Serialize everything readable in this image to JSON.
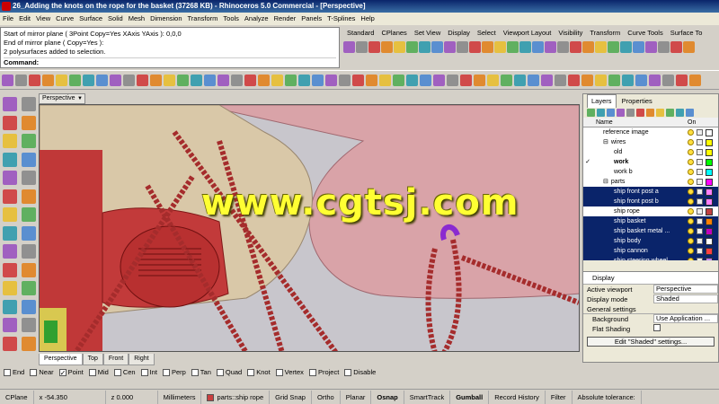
{
  "window": {
    "title": "26_Adding the knots on the rope for the basket (37268 KB) - Rhinoceros 5.0 Commercial - [Perspective]"
  },
  "menu": [
    "File",
    "Edit",
    "View",
    "Curve",
    "Surface",
    "Solid",
    "Mesh",
    "Dimension",
    "Transform",
    "Tools",
    "Analyze",
    "Render",
    "Panels",
    "T-Splines",
    "Help"
  ],
  "command_history": {
    "lines": [
      "Start of mirror plane ( 3Point  Copy=Yes  XAxis  YAxis ): 0,0,0",
      "End of mirror plane ( Copy=Yes ):",
      "2 polysurfaces added to selection."
    ],
    "prompt": "Command:"
  },
  "toolbar_tabs": [
    "Standard",
    "CPlanes",
    "Set View",
    "Display",
    "Select",
    "Viewport Layout",
    "Visibility",
    "Transform",
    "Curve Tools",
    "Surface To"
  ],
  "viewport": {
    "name": "Perspective",
    "watermark": "www.cgtsj.com",
    "tabs": [
      "Perspective",
      "Top",
      "Front",
      "Right"
    ],
    "active_tab": "Perspective"
  },
  "osnap": [
    {
      "label": "End",
      "checked": false
    },
    {
      "label": "Near",
      "checked": false
    },
    {
      "label": "Point",
      "checked": true
    },
    {
      "label": "Mid",
      "checked": false
    },
    {
      "label": "Cen",
      "checked": false
    },
    {
      "label": "Int",
      "checked": false
    },
    {
      "label": "Perp",
      "checked": false
    },
    {
      "label": "Tan",
      "checked": false
    },
    {
      "label": "Quad",
      "checked": false
    },
    {
      "label": "Knot",
      "checked": false
    },
    {
      "label": "Vertex",
      "checked": false
    },
    {
      "label": "Project",
      "checked": false
    },
    {
      "label": "Disable",
      "checked": false
    }
  ],
  "status": {
    "cplane": "CPlane",
    "x": "x -54.350",
    "z": "z 0.000",
    "units": "Millimeters",
    "layer": "parts::ship rope",
    "toggles": [
      "Grid Snap",
      "Ortho",
      "Planar",
      "Osnap",
      "SmartTrack",
      "Gumball",
      "Record History",
      "Filter",
      "Absolute tolerance:"
    ],
    "bold_toggles": [
      "Osnap",
      "Gumball"
    ]
  },
  "panels": {
    "tabs": [
      "Layers",
      "Properties"
    ],
    "active": "Layers",
    "columns": {
      "name": "Name",
      "on": "On"
    },
    "layers": [
      {
        "name": "reference image",
        "indent": 1,
        "current": false,
        "selected": false,
        "color": "#ffffff"
      },
      {
        "name": "wires",
        "indent": 1,
        "current": false,
        "selected": false,
        "color": "#ffff00",
        "expander": "⊟"
      },
      {
        "name": "old",
        "indent": 2,
        "current": false,
        "selected": false,
        "color": "#ffff00"
      },
      {
        "name": "work",
        "indent": 2,
        "current": true,
        "selected": false,
        "color": "#00ff00",
        "check": "✓"
      },
      {
        "name": "work b",
        "indent": 2,
        "current": false,
        "selected": false,
        "color": "#00ffff"
      },
      {
        "name": "parts",
        "indent": 1,
        "current": false,
        "selected": false,
        "color": "#ff00ff",
        "expander": "⊟"
      },
      {
        "name": "ship front post a",
        "indent": 2,
        "current": false,
        "selected": true,
        "color": "#ff80ff"
      },
      {
        "name": "ship front post b",
        "indent": 2,
        "current": false,
        "selected": true,
        "color": "#ff80ff"
      },
      {
        "name": "ship rope",
        "indent": 2,
        "current": false,
        "selected": false,
        "color": "#c04040"
      },
      {
        "name": "ship basket",
        "indent": 2,
        "current": false,
        "selected": true,
        "color": "#ff8000"
      },
      {
        "name": "ship basket metal ...",
        "indent": 2,
        "current": false,
        "selected": true,
        "color": "#c000c0"
      },
      {
        "name": "ship body",
        "indent": 2,
        "current": false,
        "selected": true,
        "color": "#ffffff"
      },
      {
        "name": "ship cannon",
        "indent": 2,
        "current": false,
        "selected": true,
        "color": "#ff4040"
      },
      {
        "name": "ship steering wheel",
        "indent": 2,
        "current": false,
        "selected": true,
        "color": "#c080ff"
      }
    ]
  },
  "display_panel": {
    "title": "Display",
    "active_viewport_label": "Active viewport",
    "active_viewport": "Perspective",
    "display_mode_label": "Display mode",
    "display_mode": "Shaded",
    "section": "General settings",
    "background_label": "Background",
    "background": "Use Application ...",
    "flat_shading_label": "Flat Shading",
    "button": "Edit \"Shaded\" settings..."
  }
}
